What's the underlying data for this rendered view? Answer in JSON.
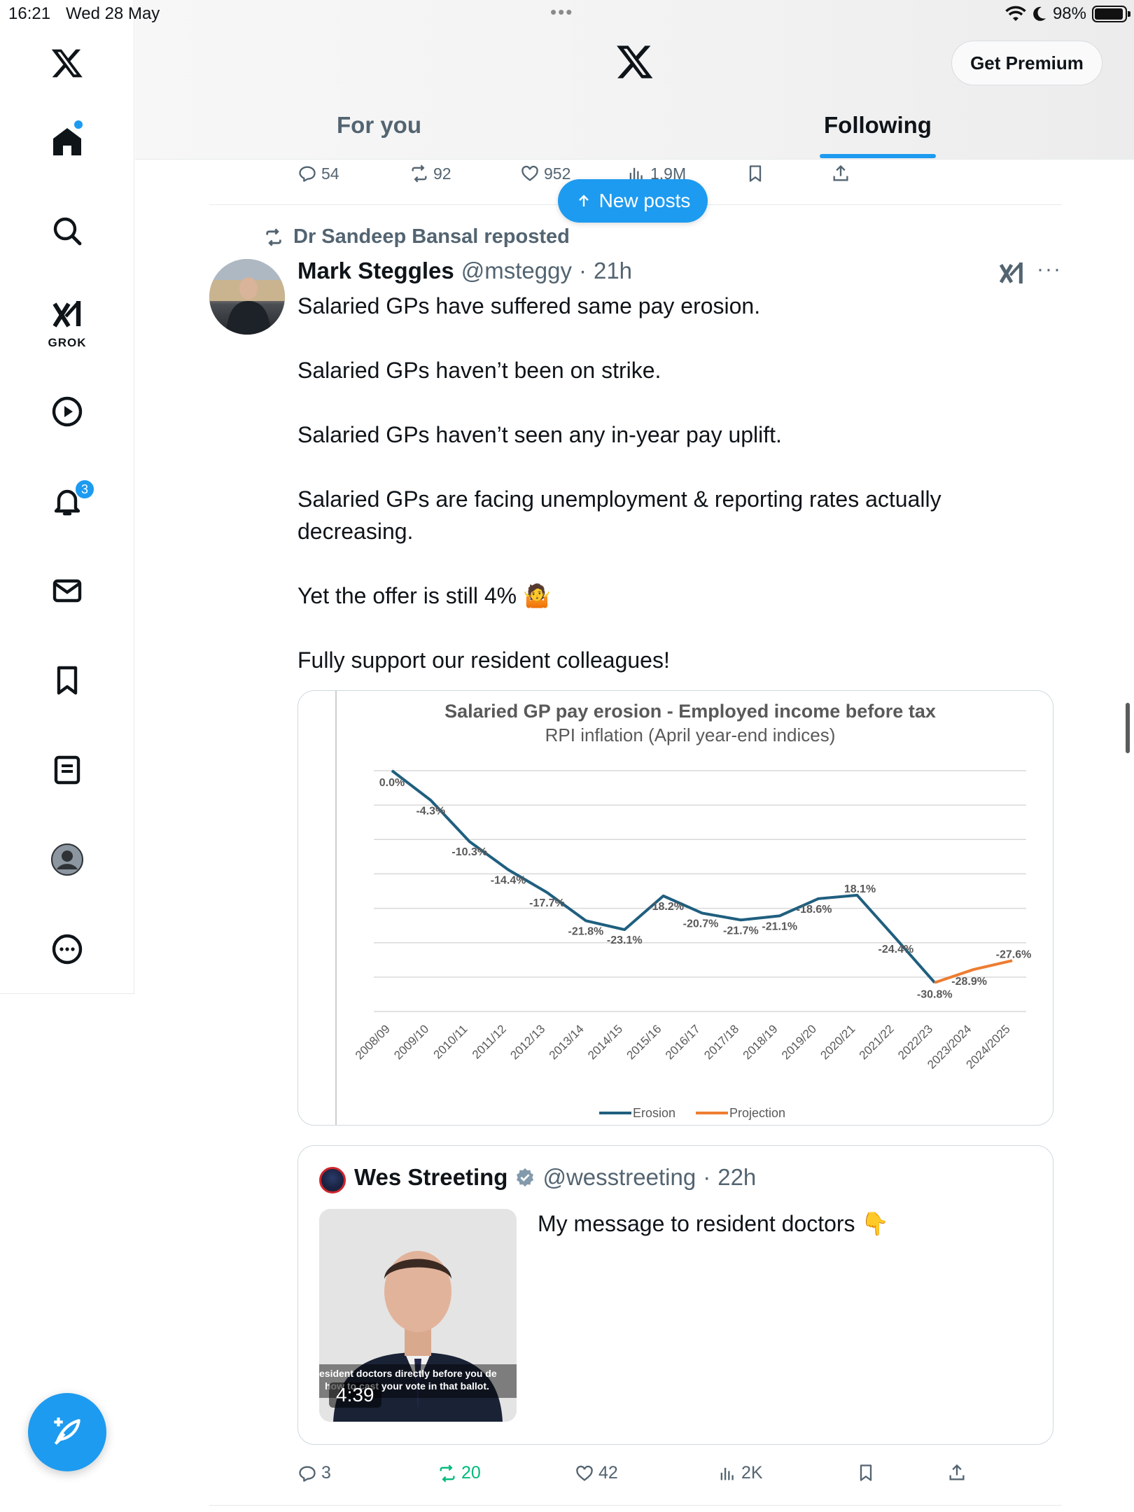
{
  "status_bar": {
    "time": "16:21",
    "date": "Wed 28 May",
    "battery": "98%"
  },
  "header": {
    "premium_label": "Get Premium",
    "tabs": [
      {
        "label": "For you",
        "active": false
      },
      {
        "label": "Following",
        "active": true
      }
    ],
    "accent": "#1d9bf0"
  },
  "sidebar": {
    "grok_label": "GROK",
    "notifications_count": "3"
  },
  "previous_post_actions": {
    "replies": "54",
    "reposts": "92",
    "likes": "952",
    "views": "1.9M"
  },
  "new_posts_label": "New posts",
  "post": {
    "reposted_by": "Dr Sandeep Bansal reposted",
    "author_name": "Mark Steggles",
    "author_handle": "@msteggy",
    "time": "21h",
    "paragraphs": [
      "Salaried GPs have suffered same pay erosion.",
      "Salaried GPs haven’t been on strike.",
      "Salaried GPs haven’t seen any in-year pay uplift.",
      "Salaried GPs are facing unemployment & reporting rates actually decreasing.",
      "Yet the offer is still 4% 🤷",
      "Fully support our resident colleagues!"
    ],
    "actions": {
      "replies": "3",
      "reposts": "20",
      "likes": "42",
      "views": "2K"
    }
  },
  "chart_data": {
    "type": "line",
    "title": "Salaried GP pay erosion - Employed income before tax",
    "subtitle": "RPI inflation (April year-end indices)",
    "categories": [
      "2008/09",
      "2009/10",
      "2010/11",
      "2011/12",
      "2012/13",
      "2013/14",
      "2014/15",
      "2015/16",
      "2016/17",
      "2017/18",
      "2018/19",
      "2019/20",
      "2020/21",
      "2021/22",
      "2022/23",
      "2023/2024",
      "2024/2025"
    ],
    "series": [
      {
        "name": "Erosion",
        "color": "#1f5f7f",
        "values": [
          0.0,
          -4.3,
          -10.3,
          -14.4,
          -17.7,
          -21.8,
          -23.1,
          -18.2,
          -20.7,
          -21.7,
          -21.1,
          -18.6,
          -18.1,
          -24.4,
          -30.8,
          null,
          null
        ],
        "labels": [
          "0.0%",
          "-4.3%",
          "-10.3%",
          "-14.4%",
          "-17.7%",
          "-21.8%",
          "-23.1%",
          "-18.2%",
          "-20.7%",
          "-21.7%",
          "-21.1%",
          "-18.6%",
          "18.1%",
          "-24.4%",
          "-30.8%",
          "",
          ""
        ]
      },
      {
        "name": "Projection",
        "color": "#ed7d31",
        "values": [
          null,
          null,
          null,
          null,
          null,
          null,
          null,
          null,
          null,
          null,
          null,
          null,
          null,
          null,
          -30.8,
          -28.9,
          -27.6
        ],
        "labels": [
          "",
          "",
          "",
          "",
          "",
          "",
          "",
          "",
          "",
          "",
          "",
          "",
          "",
          "",
          "",
          "-28.9%",
          "-27.6%"
        ]
      }
    ],
    "ylim": [
      -35,
      0
    ],
    "grid": true,
    "legend": "bottom"
  },
  "quote": {
    "author_name": "Wes Streeting",
    "author_handle": "@wesstreeting",
    "time": "22h",
    "text": "My message to resident doctors 👇",
    "video_duration": "4:39",
    "video_caption_1": "esident doctors directly before you de",
    "video_caption_2": "how to cast your vote in that ballot."
  }
}
